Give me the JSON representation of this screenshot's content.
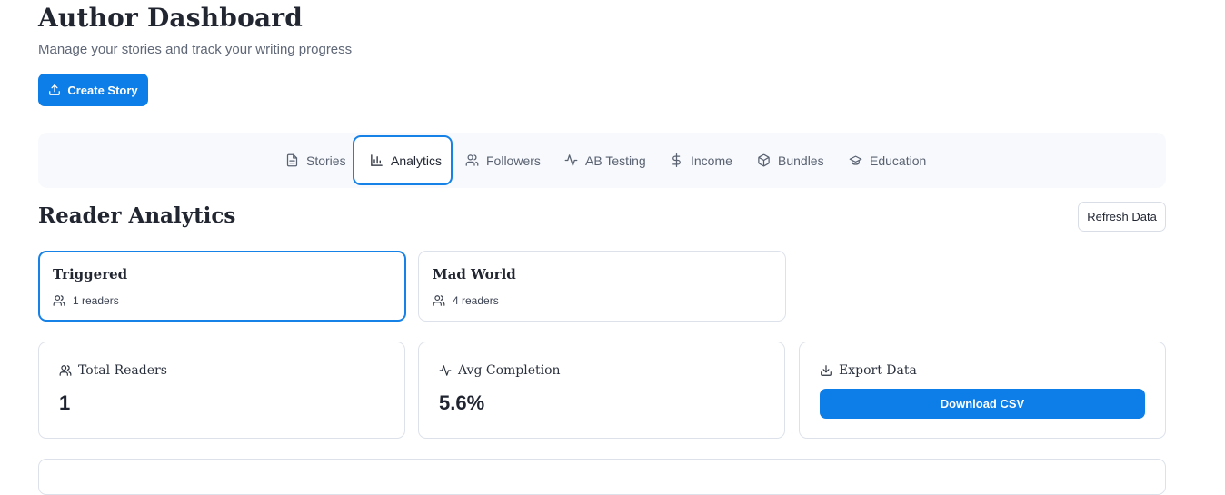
{
  "header": {
    "title": "Author Dashboard",
    "subtitle": "Manage your stories and track your writing progress",
    "create_button": "Create Story"
  },
  "tabs": [
    {
      "label": "Stories",
      "icon": "document-icon"
    },
    {
      "label": "Analytics",
      "icon": "bar-chart-icon",
      "active": true
    },
    {
      "label": "Followers",
      "icon": "users-icon"
    },
    {
      "label": "AB Testing",
      "icon": "activity-icon"
    },
    {
      "label": "Income",
      "icon": "dollar-icon"
    },
    {
      "label": "Bundles",
      "icon": "package-icon"
    },
    {
      "label": "Education",
      "icon": "graduation-cap-icon"
    }
  ],
  "analytics": {
    "title": "Reader Analytics",
    "refresh_button": "Refresh Data",
    "stories": [
      {
        "name": "Triggered",
        "readers": "1 readers",
        "selected": true
      },
      {
        "name": "Mad World",
        "readers": "4 readers",
        "selected": false
      }
    ],
    "stats": {
      "total_readers_label": "Total Readers",
      "total_readers_value": "1",
      "avg_completion_label": "Avg Completion",
      "avg_completion_value": "5.6%",
      "export_label": "Export Data",
      "download_button": "Download CSV"
    }
  },
  "colors": {
    "accent": "#0d7de8",
    "active_tab_border": "#1681e6",
    "tabbar_bg": "#f7f9fc"
  }
}
